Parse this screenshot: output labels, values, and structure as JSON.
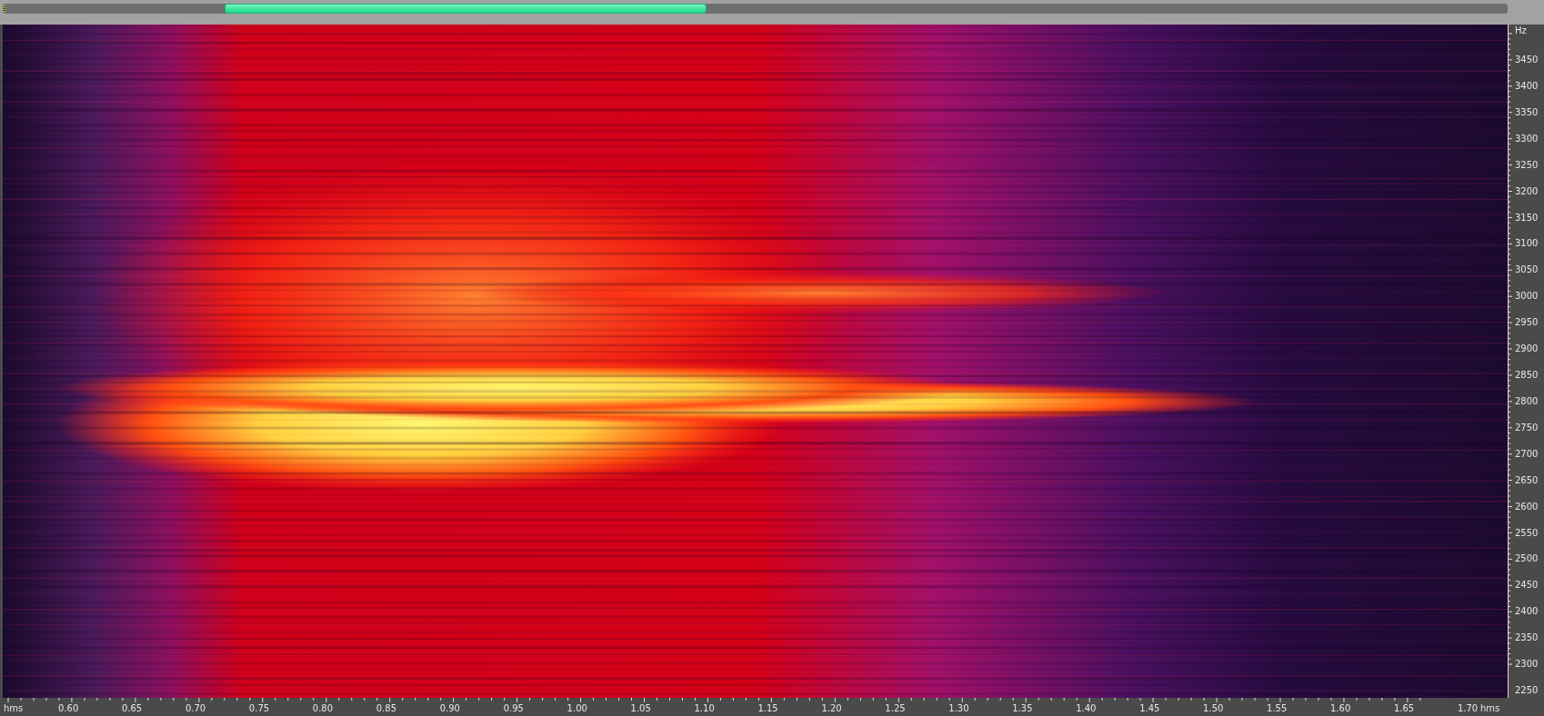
{
  "frequency_axis": {
    "unit": "Hz",
    "ticks": [
      "3450",
      "3400",
      "3350",
      "3300",
      "3250",
      "3200",
      "3150",
      "3100",
      "3050",
      "3000",
      "2950",
      "2900",
      "2850",
      "2800",
      "2750",
      "2700",
      "2650",
      "2600",
      "2550",
      "2500",
      "2450",
      "2400",
      "2350",
      "2300",
      "2250"
    ]
  },
  "time_axis": {
    "start_label": "hms",
    "end_label": "hms",
    "ticks": [
      "0.60",
      "0.65",
      "0.70",
      "0.75",
      "0.80",
      "0.85",
      "0.90",
      "0.95",
      "1.00",
      "1.05",
      "1.10",
      "1.15",
      "1.20",
      "1.25",
      "1.30",
      "1.35",
      "1.40",
      "1.45",
      "1.50",
      "1.55",
      "1.60",
      "1.65",
      "1.70"
    ]
  }
}
